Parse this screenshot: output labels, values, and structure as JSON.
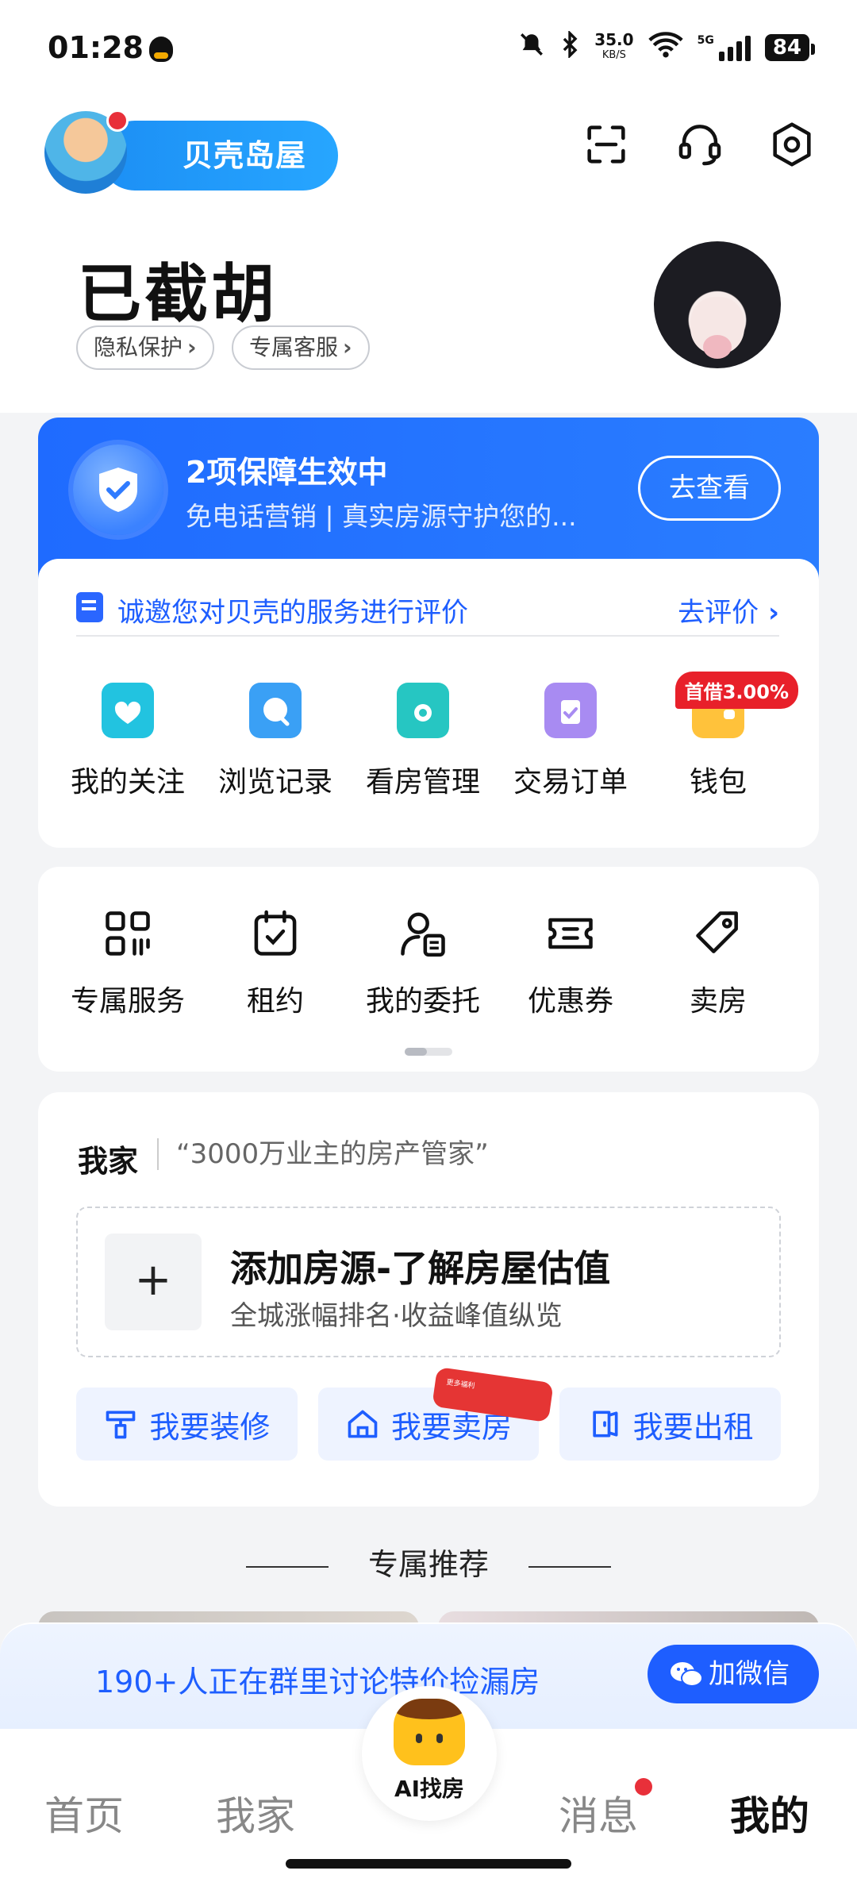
{
  "status_bar": {
    "time": "01:28",
    "speed_value": "35.0",
    "speed_unit": "KB/S",
    "network": "5G",
    "battery": "84"
  },
  "header": {
    "logo_text": "贝壳岛屋",
    "icons": [
      "scan-icon",
      "headset-icon",
      "settings-icon"
    ]
  },
  "profile": {
    "username": "已截胡",
    "chips": [
      "隐私保护",
      "专属客服"
    ]
  },
  "protection": {
    "title": "2项保障生效中",
    "subtitle": "免电话营销 | 真实房源守护您的...",
    "button": "去查看"
  },
  "rating": {
    "text": "诚邀您对贝壳的服务进行评价",
    "link": "去评价"
  },
  "quick_icons": [
    {
      "label": "我的关注",
      "color": "#22c3e0"
    },
    {
      "label": "浏览记录",
      "color": "#3aa0f5"
    },
    {
      "label": "看房管理",
      "color": "#26c6c2"
    },
    {
      "label": "交易订单",
      "color": "#a88bf2"
    },
    {
      "label": "钱包",
      "color": "#ffc23b",
      "badge": "首借3.00%"
    }
  ],
  "services": [
    {
      "label": "专属服务",
      "icon": "grid-icon"
    },
    {
      "label": "租约",
      "icon": "calendar-icon"
    },
    {
      "label": "我的委托",
      "icon": "person-doc-icon"
    },
    {
      "label": "优惠券",
      "icon": "ticket-icon"
    },
    {
      "label": "卖房",
      "icon": "tag-icon"
    }
  ],
  "my_home": {
    "title": "我家",
    "subtitle": "“3000万业主的房产管家”",
    "add_title": "添加房源-了解房屋估值",
    "add_subtitle": "全城涨幅排名·收益峰值纵览",
    "actions": [
      "我要装修",
      "我要卖房",
      "我要出租"
    ],
    "sell_tag": "更多福利"
  },
  "recommend_title": "专属推荐",
  "group_banner": {
    "text": "190+人正在群里讨论特价捡漏房",
    "button": "加微信"
  },
  "tabbar": {
    "tabs": [
      "首页",
      "我家",
      "AI找房",
      "消息",
      "我的"
    ],
    "active": "我的"
  }
}
